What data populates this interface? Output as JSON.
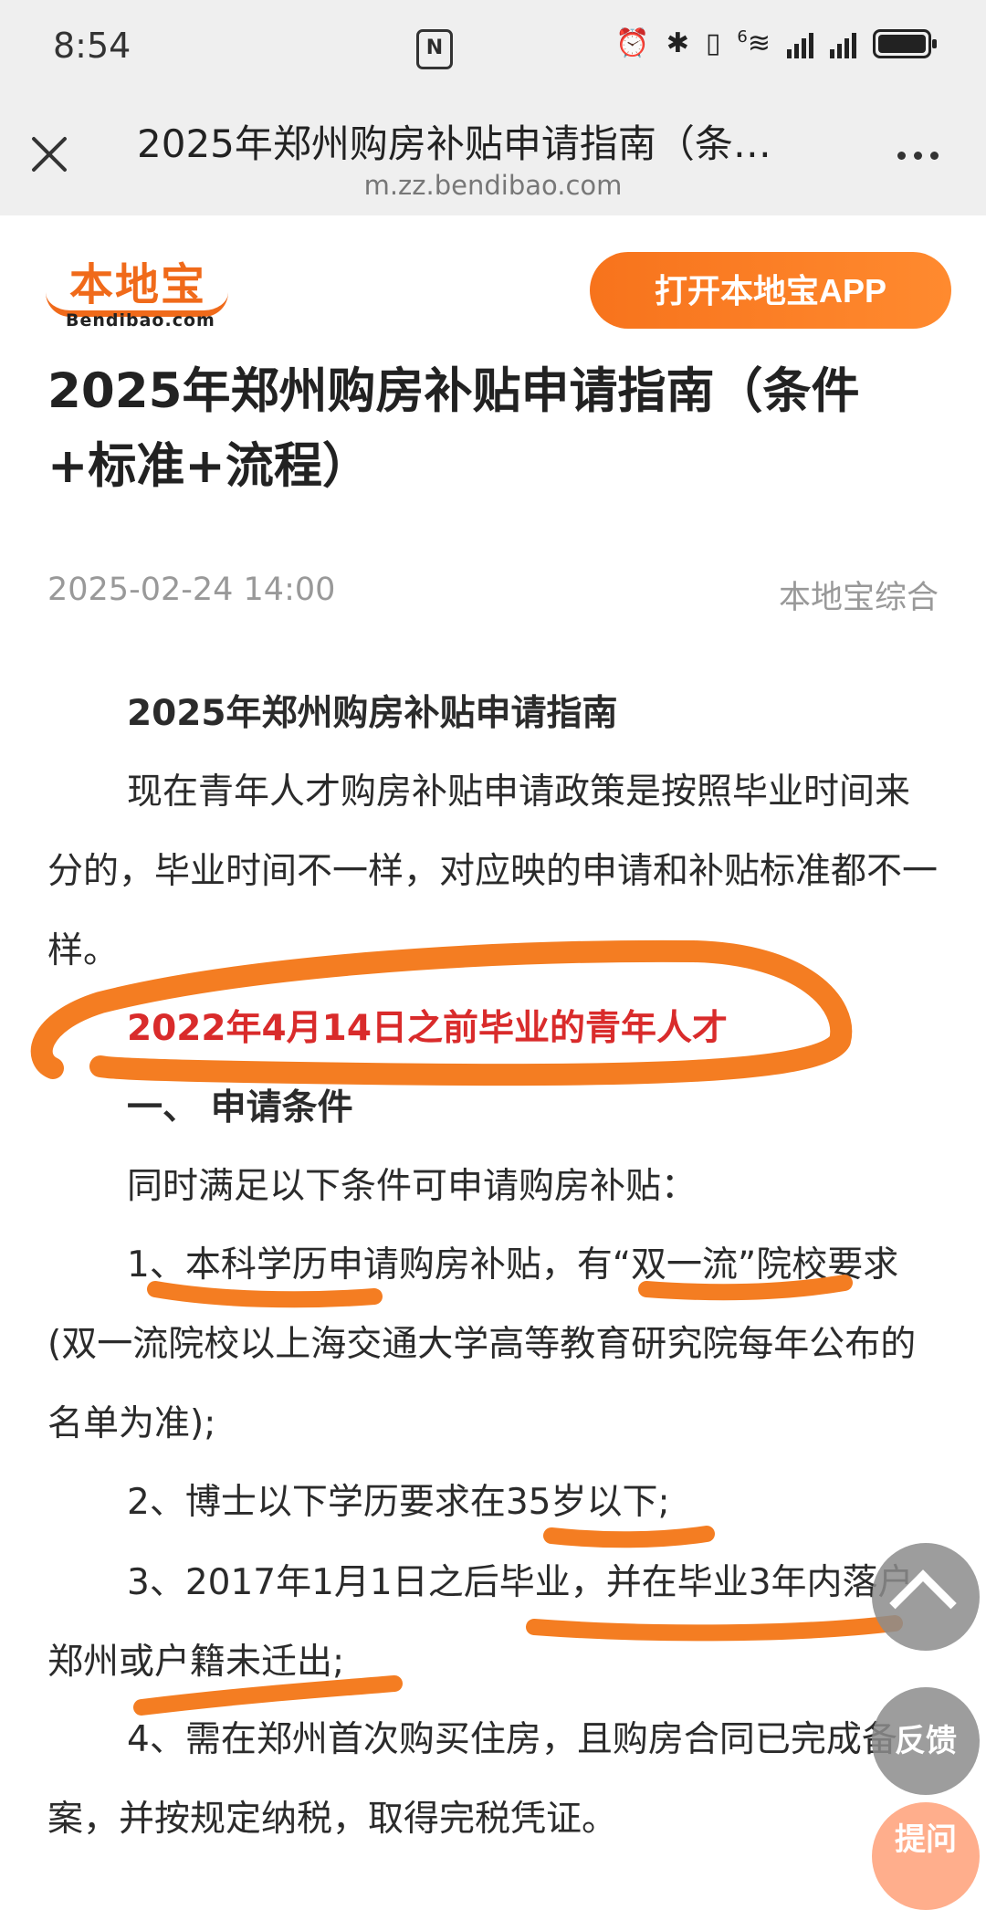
{
  "status_bar": {
    "time": "8:54",
    "nfc": "N",
    "wifi_label": "6"
  },
  "browser": {
    "tab_title": "2025年郑州购房补贴申请指南（条…",
    "url": "m.zz.bendibao.com"
  },
  "site": {
    "logo_text": "本地宝",
    "logo_domain": "Bendibao.com",
    "open_app_label": "打开本地宝APP"
  },
  "article": {
    "title": "2025年郑州购房补贴申请指南（条件+标准+流程）",
    "date": "2025-02-24 14:00",
    "source": "本地宝综合",
    "heading": "2025年郑州购房补贴申请指南",
    "intro": "现在青年人才购房补贴申请政策是按照毕业时间来分的，毕业时间不一样，对应映的申请和补贴标准都不一样。",
    "highlight": "2022年4月14日之前毕业的青年人才",
    "section1": "一、 申请条件",
    "conditions_intro": "同时满足以下条件可申请购房补贴：",
    "conditions": [
      "1、本科学历申请购房补贴，有“双一流”院校要求(双一流院校以上海交通大学高等教育研究院每年公布的名单为准);",
      "2、博士以下学历要求在35岁以下;",
      "3、2017年1月1日之后毕业，并在毕业3年内落户郑州或户籍未迁出;",
      "4、需在郑州首次购买住房，且购房合同已完成备案，并按规定纳税，取得完税凭证。"
    ]
  },
  "floating": {
    "feedback": "反馈",
    "ask": "提问"
  },
  "colors": {
    "accent": "#f7731c",
    "highlight_red": "#d92b2b",
    "annotation_orange": "#f47d22"
  }
}
